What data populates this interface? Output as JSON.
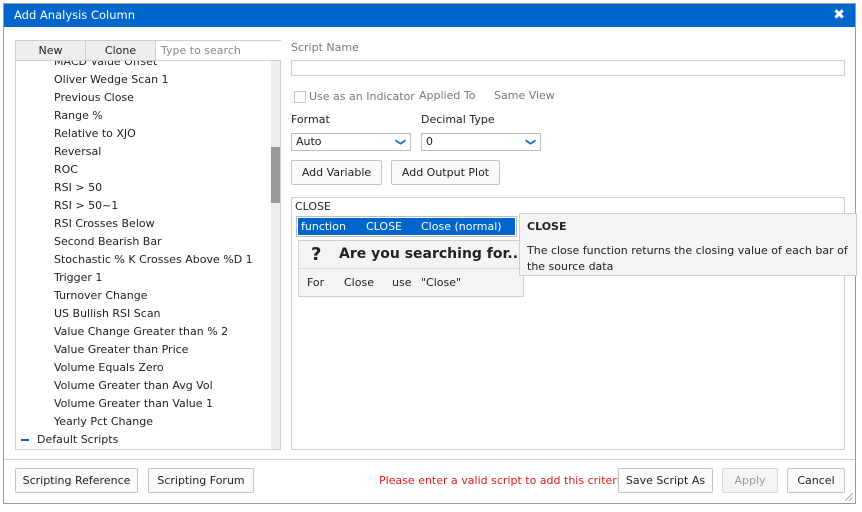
{
  "window": {
    "title": "Add Analysis Column"
  },
  "left_panel": {
    "new_label": "New",
    "clone_label": "Clone",
    "search_placeholder": "Type to search",
    "items": [
      "MACD Value Offset",
      "Oliver Wedge Scan 1",
      "Previous Close",
      "Range %",
      "Relative to XJO",
      "Reversal",
      "ROC",
      "RSI > 50",
      "RSI > 50~1",
      "RSI Crosses Below",
      "Second Bearish Bar",
      "Stochastic % K Crosses Above %D 1",
      "Trigger 1",
      "Turnover Change",
      "US Bullish RSI Scan",
      "Value Change Greater than % 2",
      "Value Greater than Price",
      "Volume Equals Zero",
      "Volume Greater than Avg Vol",
      "Volume Greater than Value 1",
      "Yearly Pct Change"
    ],
    "group_label": "Default Scripts",
    "scroll_position": 0.3
  },
  "form": {
    "script_name_label": "Script Name",
    "script_name_value": "",
    "use_indicator_label": "Use as an Indicator",
    "use_indicator_checked": false,
    "applied_to_label": "Applied To",
    "applied_to_value": "Same View",
    "format_label": "Format",
    "format_value": "Auto",
    "decimal_type_label": "Decimal Type",
    "decimal_type_value": "0",
    "add_variable_label": "Add Variable",
    "add_output_plot_label": "Add Output Plot"
  },
  "editor": {
    "code": "CLOSE",
    "autocomplete": {
      "kind": "function",
      "name": "CLOSE",
      "desc": "Close (normal)"
    },
    "hint": {
      "icon": "?",
      "title": "Are you searching for...",
      "row": [
        "For",
        "Close",
        "use",
        "\"Close\""
      ]
    },
    "tooltip": {
      "title": "CLOSE",
      "description": "The close function returns the closing value of each bar of the source data"
    }
  },
  "footer": {
    "scripting_reference_label": "Scripting Reference",
    "scripting_forum_label": "Scripting Forum",
    "error_message": "Please enter a valid script to add this criteria",
    "save_script_as_label": "Save Script As",
    "apply_label": "Apply",
    "cancel_label": "Cancel"
  }
}
